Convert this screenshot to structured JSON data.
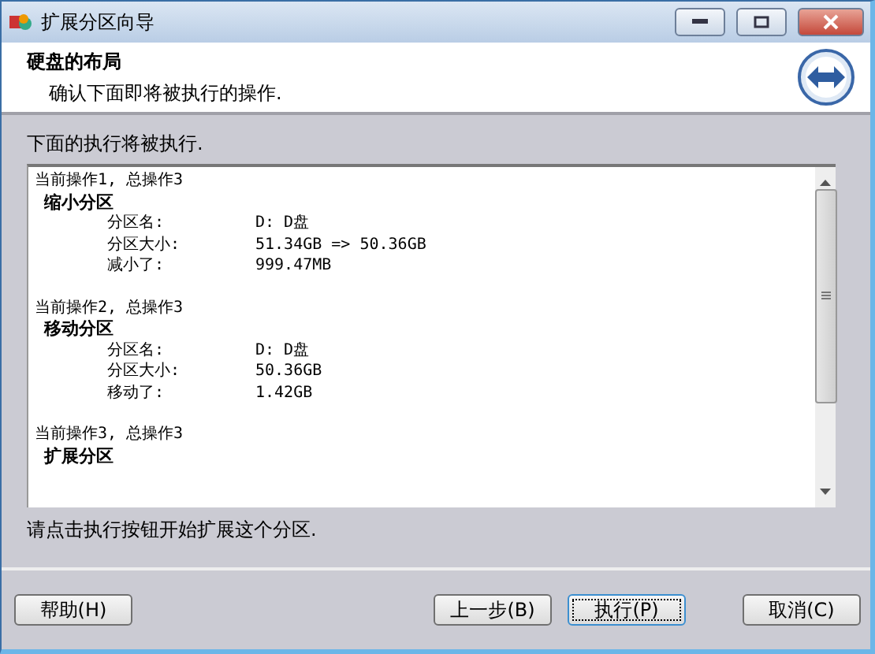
{
  "window": {
    "title": "扩展分区向导"
  },
  "header": {
    "title": "硬盘的布局",
    "subtitle": "确认下面即将被执行的操作."
  },
  "intro": "下面的执行将被执行.",
  "operations": [
    {
      "counter": "当前操作1, 总操作3",
      "name": "缩小分区",
      "fields": [
        {
          "label": "分区名:",
          "value": "D: D盘"
        },
        {
          "label": "分区大小:",
          "value": "51.34GB => 50.36GB"
        },
        {
          "label": "减小了:",
          "value": "999.47MB"
        }
      ]
    },
    {
      "counter": "当前操作2, 总操作3",
      "name": "移动分区",
      "fields": [
        {
          "label": "分区名:",
          "value": "D: D盘"
        },
        {
          "label": "分区大小:",
          "value": "50.36GB"
        },
        {
          "label": "移动了:",
          "value": "1.42GB"
        }
      ]
    },
    {
      "counter": "当前操作3, 总操作3",
      "name": "扩展分区"
    }
  ],
  "hint": "请点击执行按钮开始扩展这个分区.",
  "buttons": [
    {
      "label": "帮助(H)",
      "focused": false
    },
    {
      "label": "上一步(B)",
      "focused": false
    },
    {
      "label": "执行(P)",
      "focused": true
    },
    {
      "label": "取消(C)",
      "focused": false
    }
  ]
}
